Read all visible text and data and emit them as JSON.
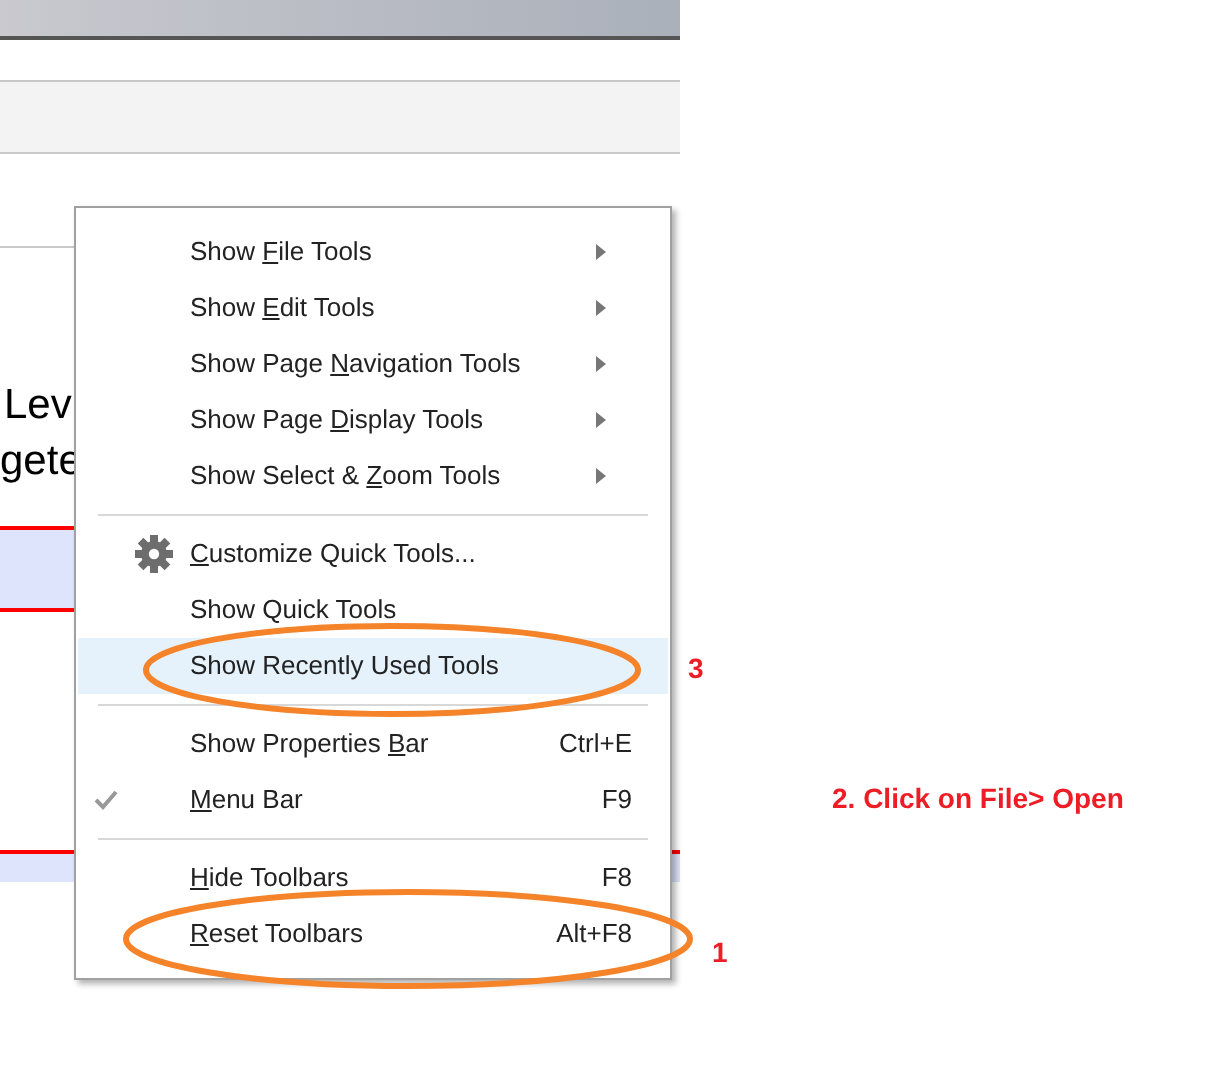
{
  "document": {
    "fragments": [
      "Lev",
      "gete"
    ]
  },
  "context_menu": {
    "items": [
      {
        "kind": "submenu",
        "label_parts": [
          {
            "text": "Show "
          },
          {
            "text": "F",
            "underlined": true
          },
          {
            "text": "ile Tools"
          }
        ]
      },
      {
        "kind": "submenu",
        "label_parts": [
          {
            "text": "Show "
          },
          {
            "text": "E",
            "underlined": true
          },
          {
            "text": "dit Tools"
          }
        ]
      },
      {
        "kind": "submenu",
        "label_parts": [
          {
            "text": "Show Page "
          },
          {
            "text": "N",
            "underlined": true
          },
          {
            "text": "avigation Tools"
          }
        ]
      },
      {
        "kind": "submenu",
        "label_parts": [
          {
            "text": "Show Page "
          },
          {
            "text": "D",
            "underlined": true
          },
          {
            "text": "isplay Tools"
          }
        ]
      },
      {
        "kind": "submenu",
        "label_parts": [
          {
            "text": "Show Select & "
          },
          {
            "text": "Z",
            "underlined": true
          },
          {
            "text": "oom Tools"
          }
        ]
      },
      {
        "kind": "separator"
      },
      {
        "kind": "gear_item",
        "label_parts": [
          {
            "text": "C",
            "underlined": true
          },
          {
            "text": "ustomize Quick Tools..."
          }
        ],
        "selected": false
      },
      {
        "kind": "item",
        "label_parts": [
          {
            "text": "Show Quick Tools"
          }
        ],
        "selected": false
      },
      {
        "kind": "item",
        "label_parts": [
          {
            "text": "Show Recently Used Tools"
          }
        ],
        "selected": true
      },
      {
        "kind": "separator"
      },
      {
        "kind": "item",
        "label_parts": [
          {
            "text": "Show Properties "
          },
          {
            "text": "B",
            "underlined": true
          },
          {
            "text": "ar"
          }
        ],
        "shortcut": "Ctrl+E",
        "selected": false
      },
      {
        "kind": "item",
        "label_parts": [
          {
            "text": "M",
            "underlined": true
          },
          {
            "text": "enu Bar"
          }
        ],
        "shortcut": "F9",
        "checked": true,
        "selected": false
      },
      {
        "kind": "separator"
      },
      {
        "kind": "item",
        "label_parts": [
          {
            "text": "H",
            "underlined": true
          },
          {
            "text": "ide Toolbars"
          }
        ],
        "shortcut": "F8",
        "selected": false
      },
      {
        "kind": "item",
        "label_parts": [
          {
            "text": "R",
            "underlined": true
          },
          {
            "text": "eset Toolbars"
          }
        ],
        "shortcut": "Alt+F8",
        "selected": false
      }
    ]
  },
  "annotations": [
    {
      "text": "3"
    },
    {
      "text": "2. Click on File> Open"
    },
    {
      "text": "1"
    }
  ]
}
